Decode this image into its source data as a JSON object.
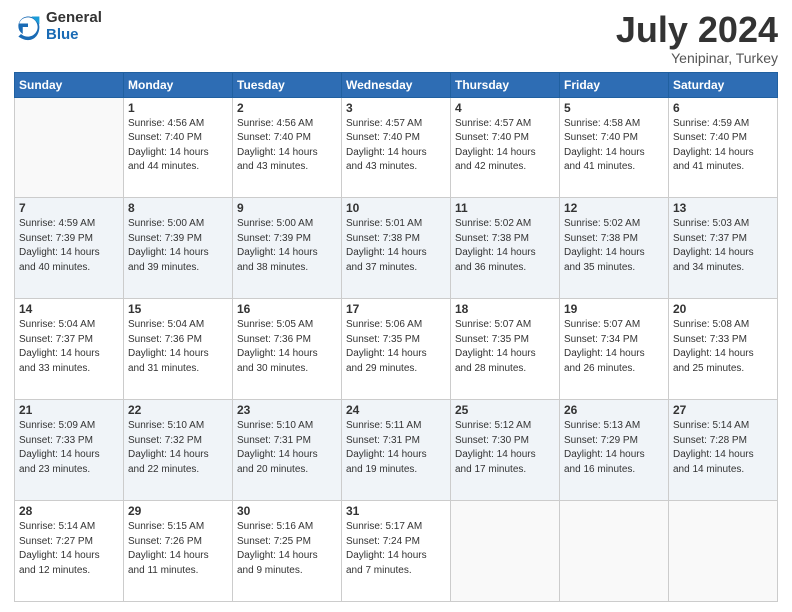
{
  "logo": {
    "general": "General",
    "blue": "Blue"
  },
  "header": {
    "title": "July 2024",
    "subtitle": "Yenipinar, Turkey"
  },
  "weekdays": [
    "Sunday",
    "Monday",
    "Tuesday",
    "Wednesday",
    "Thursday",
    "Friday",
    "Saturday"
  ],
  "weeks": [
    [
      {
        "day": "",
        "info": ""
      },
      {
        "day": "1",
        "info": "Sunrise: 4:56 AM\nSunset: 7:40 PM\nDaylight: 14 hours\nand 44 minutes."
      },
      {
        "day": "2",
        "info": "Sunrise: 4:56 AM\nSunset: 7:40 PM\nDaylight: 14 hours\nand 43 minutes."
      },
      {
        "day": "3",
        "info": "Sunrise: 4:57 AM\nSunset: 7:40 PM\nDaylight: 14 hours\nand 43 minutes."
      },
      {
        "day": "4",
        "info": "Sunrise: 4:57 AM\nSunset: 7:40 PM\nDaylight: 14 hours\nand 42 minutes."
      },
      {
        "day": "5",
        "info": "Sunrise: 4:58 AM\nSunset: 7:40 PM\nDaylight: 14 hours\nand 41 minutes."
      },
      {
        "day": "6",
        "info": "Sunrise: 4:59 AM\nSunset: 7:40 PM\nDaylight: 14 hours\nand 41 minutes."
      }
    ],
    [
      {
        "day": "7",
        "info": "Sunrise: 4:59 AM\nSunset: 7:39 PM\nDaylight: 14 hours\nand 40 minutes."
      },
      {
        "day": "8",
        "info": "Sunrise: 5:00 AM\nSunset: 7:39 PM\nDaylight: 14 hours\nand 39 minutes."
      },
      {
        "day": "9",
        "info": "Sunrise: 5:00 AM\nSunset: 7:39 PM\nDaylight: 14 hours\nand 38 minutes."
      },
      {
        "day": "10",
        "info": "Sunrise: 5:01 AM\nSunset: 7:38 PM\nDaylight: 14 hours\nand 37 minutes."
      },
      {
        "day": "11",
        "info": "Sunrise: 5:02 AM\nSunset: 7:38 PM\nDaylight: 14 hours\nand 36 minutes."
      },
      {
        "day": "12",
        "info": "Sunrise: 5:02 AM\nSunset: 7:38 PM\nDaylight: 14 hours\nand 35 minutes."
      },
      {
        "day": "13",
        "info": "Sunrise: 5:03 AM\nSunset: 7:37 PM\nDaylight: 14 hours\nand 34 minutes."
      }
    ],
    [
      {
        "day": "14",
        "info": "Sunrise: 5:04 AM\nSunset: 7:37 PM\nDaylight: 14 hours\nand 33 minutes."
      },
      {
        "day": "15",
        "info": "Sunrise: 5:04 AM\nSunset: 7:36 PM\nDaylight: 14 hours\nand 31 minutes."
      },
      {
        "day": "16",
        "info": "Sunrise: 5:05 AM\nSunset: 7:36 PM\nDaylight: 14 hours\nand 30 minutes."
      },
      {
        "day": "17",
        "info": "Sunrise: 5:06 AM\nSunset: 7:35 PM\nDaylight: 14 hours\nand 29 minutes."
      },
      {
        "day": "18",
        "info": "Sunrise: 5:07 AM\nSunset: 7:35 PM\nDaylight: 14 hours\nand 28 minutes."
      },
      {
        "day": "19",
        "info": "Sunrise: 5:07 AM\nSunset: 7:34 PM\nDaylight: 14 hours\nand 26 minutes."
      },
      {
        "day": "20",
        "info": "Sunrise: 5:08 AM\nSunset: 7:33 PM\nDaylight: 14 hours\nand 25 minutes."
      }
    ],
    [
      {
        "day": "21",
        "info": "Sunrise: 5:09 AM\nSunset: 7:33 PM\nDaylight: 14 hours\nand 23 minutes."
      },
      {
        "day": "22",
        "info": "Sunrise: 5:10 AM\nSunset: 7:32 PM\nDaylight: 14 hours\nand 22 minutes."
      },
      {
        "day": "23",
        "info": "Sunrise: 5:10 AM\nSunset: 7:31 PM\nDaylight: 14 hours\nand 20 minutes."
      },
      {
        "day": "24",
        "info": "Sunrise: 5:11 AM\nSunset: 7:31 PM\nDaylight: 14 hours\nand 19 minutes."
      },
      {
        "day": "25",
        "info": "Sunrise: 5:12 AM\nSunset: 7:30 PM\nDaylight: 14 hours\nand 17 minutes."
      },
      {
        "day": "26",
        "info": "Sunrise: 5:13 AM\nSunset: 7:29 PM\nDaylight: 14 hours\nand 16 minutes."
      },
      {
        "day": "27",
        "info": "Sunrise: 5:14 AM\nSunset: 7:28 PM\nDaylight: 14 hours\nand 14 minutes."
      }
    ],
    [
      {
        "day": "28",
        "info": "Sunrise: 5:14 AM\nSunset: 7:27 PM\nDaylight: 14 hours\nand 12 minutes."
      },
      {
        "day": "29",
        "info": "Sunrise: 5:15 AM\nSunset: 7:26 PM\nDaylight: 14 hours\nand 11 minutes."
      },
      {
        "day": "30",
        "info": "Sunrise: 5:16 AM\nSunset: 7:25 PM\nDaylight: 14 hours\nand 9 minutes."
      },
      {
        "day": "31",
        "info": "Sunrise: 5:17 AM\nSunset: 7:24 PM\nDaylight: 14 hours\nand 7 minutes."
      },
      {
        "day": "",
        "info": ""
      },
      {
        "day": "",
        "info": ""
      },
      {
        "day": "",
        "info": ""
      }
    ]
  ]
}
